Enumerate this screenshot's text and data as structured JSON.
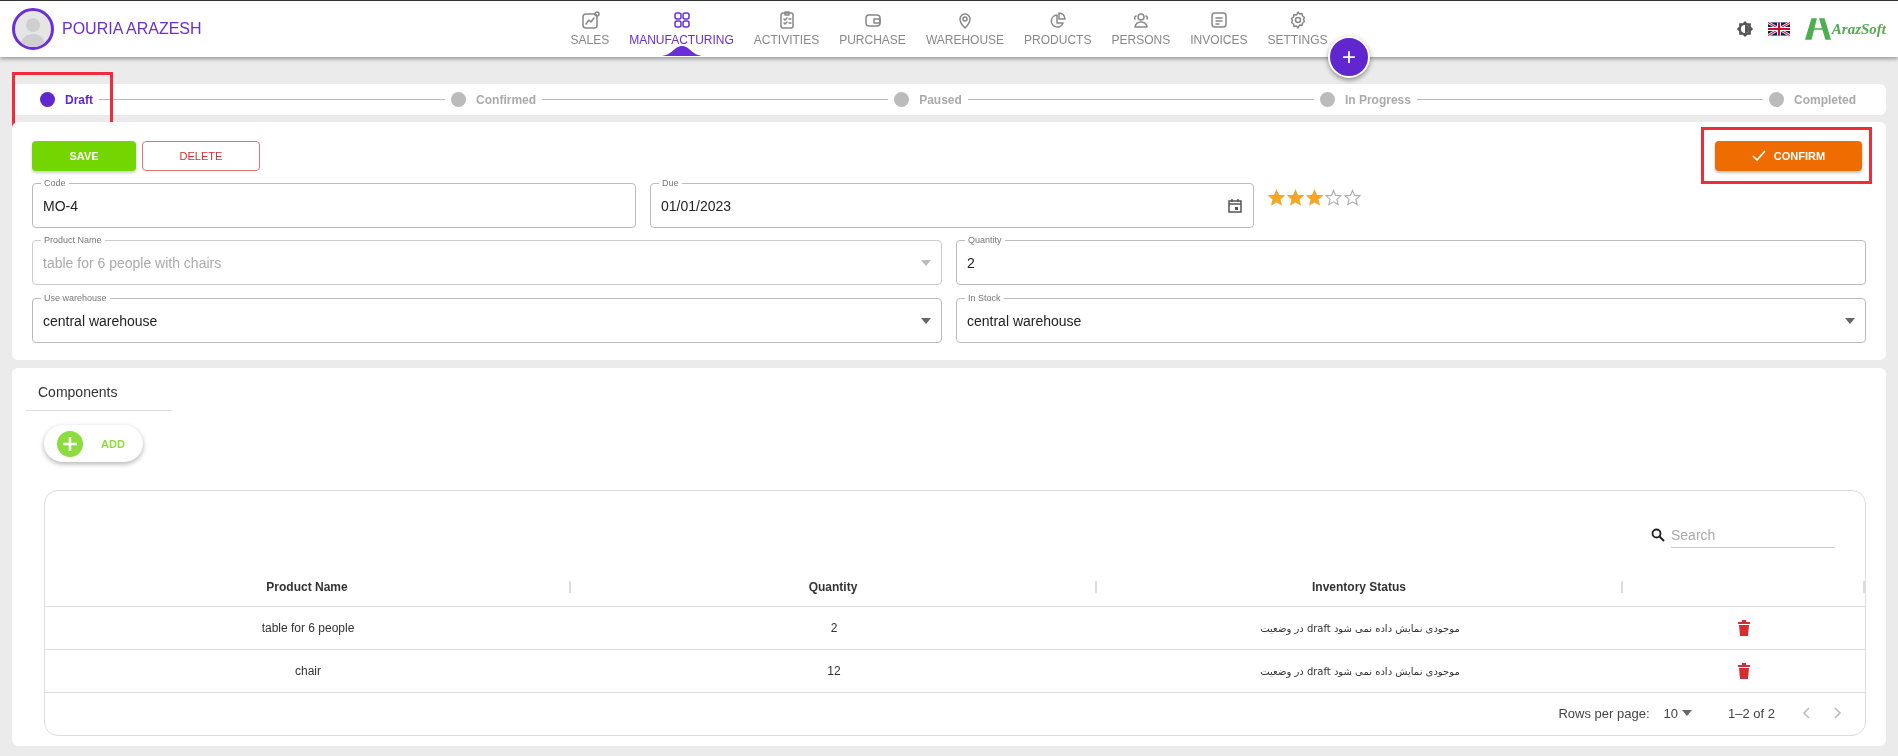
{
  "user": {
    "name": "POURIA ARAZESH"
  },
  "nav": [
    {
      "label": "SALES",
      "selected": false
    },
    {
      "label": "MANUFACTURING",
      "selected": true
    },
    {
      "label": "ACTIVITIES",
      "selected": false
    },
    {
      "label": "PURCHASE",
      "selected": false
    },
    {
      "label": "WAREHOUSE",
      "selected": false
    },
    {
      "label": "PRODUCTS",
      "selected": false
    },
    {
      "label": "PERSONS",
      "selected": false
    },
    {
      "label": "INVOICES",
      "selected": false
    },
    {
      "label": "SETTINGS",
      "selected": false
    }
  ],
  "fab": {
    "label": "+"
  },
  "logo": {
    "text": "ArazSoft"
  },
  "steps": [
    {
      "label": "Draft",
      "selected": true,
      "highlighted": true
    },
    {
      "label": "Confirmed",
      "selected": false,
      "highlighted": false
    },
    {
      "label": "Paused",
      "selected": false,
      "highlighted": false
    },
    {
      "label": "In Progress",
      "selected": false,
      "highlighted": false
    },
    {
      "label": "Completed",
      "selected": false,
      "highlighted": false
    }
  ],
  "actions": {
    "save": "SAVE",
    "delete": "DELETE",
    "confirm": {
      "label": "CONFIRM",
      "highlighted": true
    }
  },
  "rating": {
    "stars": 3
  },
  "fields": [
    {
      "kind": "text",
      "label": "Code",
      "value": "MO-4",
      "disabled": false
    },
    {
      "kind": "date",
      "label": "Due",
      "value": "01/01/2023",
      "disabled": false
    },
    {
      "kind": "select",
      "label": "Product Name",
      "value": "table for 6 people with chairs",
      "disabled": true
    },
    {
      "kind": "text",
      "label": "Quantity",
      "value": "2",
      "disabled": false
    },
    {
      "kind": "select",
      "label": "Use warehouse",
      "value": "central warehouse",
      "disabled": false
    },
    {
      "kind": "select",
      "label": "In Stock",
      "value": "central warehouse",
      "disabled": false
    }
  ],
  "components": {
    "title": "Components",
    "add": "ADD",
    "search": {
      "placeholder": "Search"
    },
    "columns": [
      "Product Name",
      "Quantity",
      "Inventory Status"
    ],
    "rows": [
      {
        "product": "table for 6 people",
        "quantity": "2",
        "status": "موجودی نمایش داده نمی شود draft در وضعیت"
      },
      {
        "product": "chair",
        "quantity": "12",
        "status": "موجودی نمایش داده نمی شود draft در وضعیت"
      }
    ],
    "pagination": {
      "rows_label": "Rows per page:",
      "rows_value": "10",
      "range": "1–2 of 2"
    }
  }
}
